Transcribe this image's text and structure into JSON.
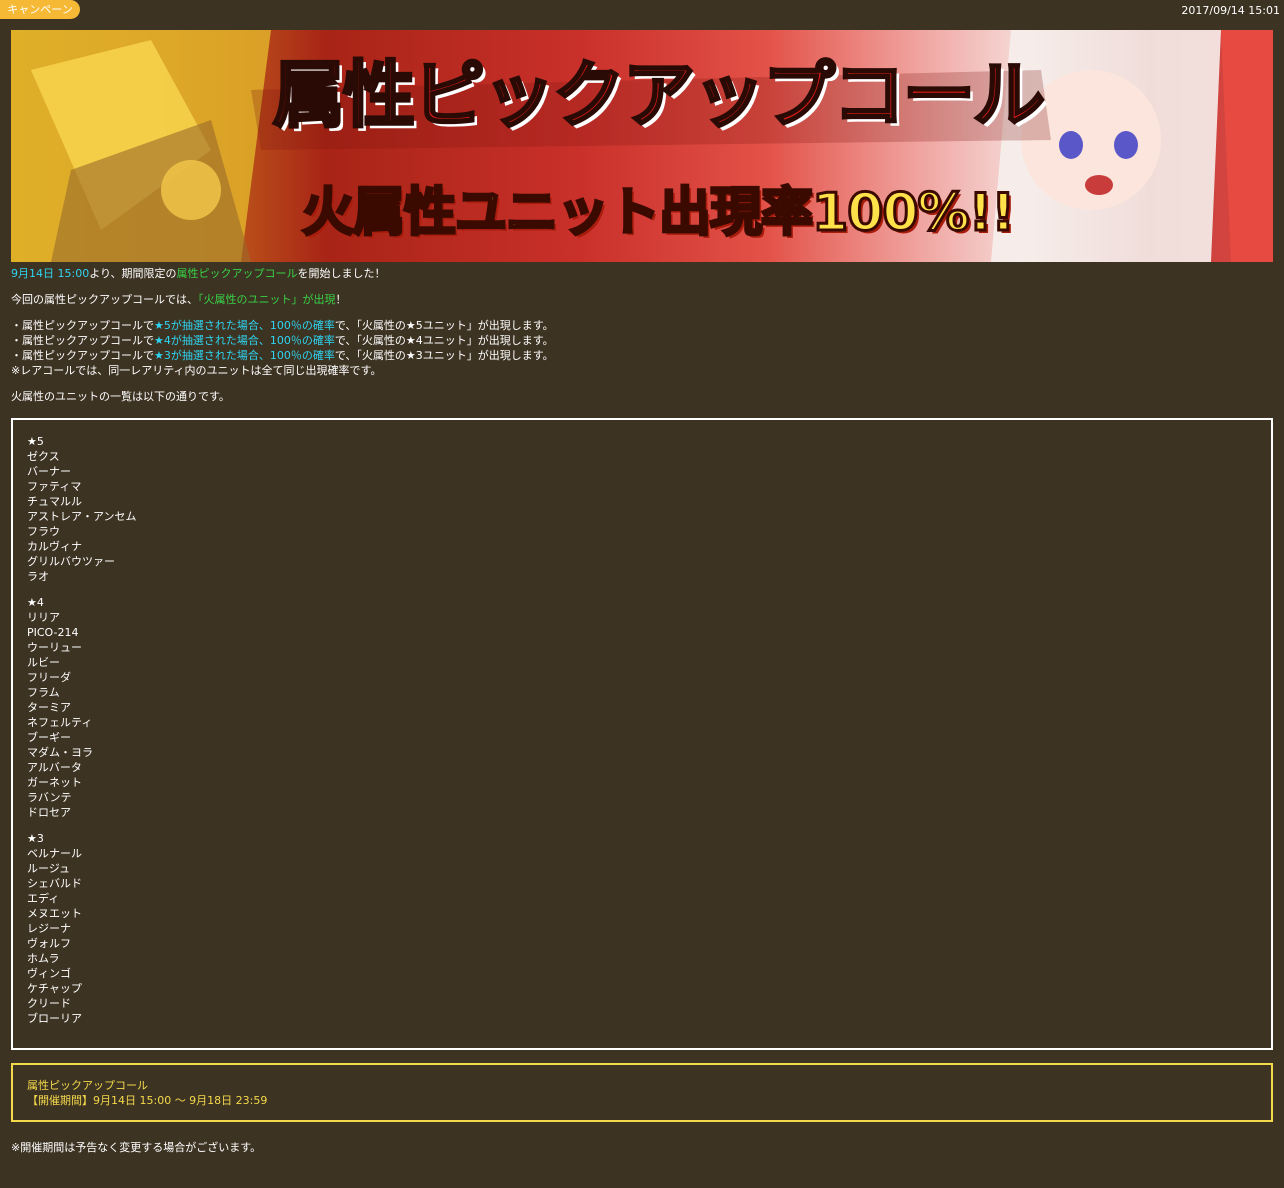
{
  "header": {
    "tag": "キャンペーン",
    "date": "2017/09/14 15:01"
  },
  "banner": {
    "title": "属性ピックアップコール",
    "subtitle": "火属性ユニット出現率100%!!"
  },
  "intro": {
    "line1_date": "9月14日 15:00",
    "line1_mid": "より、期間限定の",
    "line1_link": "属性ピックアップコール",
    "line1_end": "を開始しました！",
    "line2_start": "今回の属性ピックアップコールでは、",
    "line2_highlight": "「火属性のユニット」が出現",
    "line2_end": "！",
    "rules": [
      {
        "pre": "・属性ピックアップコールで",
        "hl": "★5が抽選された場合、100％の確率",
        "post": "で、「火属性の★5ユニット」が出現します。"
      },
      {
        "pre": "・属性ピックアップコールで",
        "hl": "★4が抽選された場合、100％の確率",
        "post": "で、「火属性の★4ユニット」が出現します。"
      },
      {
        "pre": "・属性ピックアップコールで",
        "hl": "★3が抽選された場合、100％の確率",
        "post": "で、「火属性の★3ユニット」が出現します。"
      }
    ],
    "note": "※レアコールでは、同一レアリティ内のユニットは全て同じ出現確率です。",
    "list_intro": "火属性のユニットの一覧は以下の通りです。"
  },
  "units": {
    "star5": {
      "label": "★5",
      "names": [
        "ゼクス",
        "バーナー",
        "ファティマ",
        "チュマルル",
        "アストレア・アンセム",
        "フラウ",
        "カルヴィナ",
        "グリルバウツァー",
        "ラオ"
      ]
    },
    "star4": {
      "label": "★4",
      "names": [
        "リリア",
        "PICO-214",
        "ウーリュー",
        "ルビー",
        "フリーダ",
        "フラム",
        "ターミア",
        "ネフェルティ",
        "ブーギー",
        "マダム・ヨラ",
        "アルバータ",
        "ガーネット",
        "ラバンテ",
        "ドロセア"
      ]
    },
    "star3": {
      "label": "★3",
      "names": [
        "ベルナール",
        "ルージュ",
        "シェバルド",
        "エディ",
        "メヌエット",
        "レジーナ",
        "ヴォルフ",
        "ホムラ",
        "ヴィンゴ",
        "ケチャップ",
        "クリード",
        "ブローリア"
      ]
    }
  },
  "period": {
    "title": "属性ピックアップコール",
    "dates": "【開催期間】9月14日 15:00 ～ 9月18日 23:59"
  },
  "footer_note": "※開催期間は予告なく変更する場合がございます。",
  "colors": {
    "background": "#3d3323",
    "tag": "#f5b936",
    "cyan": "#2ed4f0",
    "green": "#37d246",
    "period_border": "#f4d94a"
  }
}
